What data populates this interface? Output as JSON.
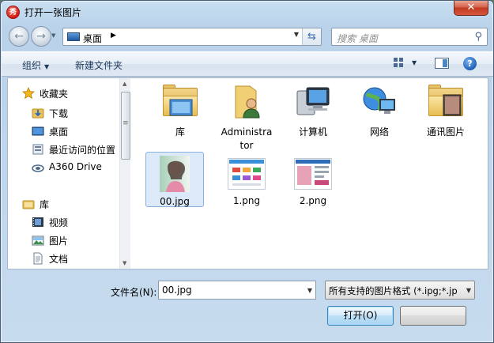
{
  "window": {
    "title": "打开一张图片",
    "app_icon_glyph": "秀",
    "close_glyph": "✕"
  },
  "nav": {
    "address_text": "桌面",
    "search_placeholder": "搜索 桌面"
  },
  "toolbar": {
    "organize_label": "组织",
    "new_folder_label": "新建文件夹",
    "help_glyph": "?"
  },
  "sidebar": {
    "items": [
      {
        "label": "收藏夹",
        "icon": "star-icon"
      },
      {
        "label": "下载",
        "icon": "download-folder-icon"
      },
      {
        "label": "桌面",
        "icon": "desktop-icon"
      },
      {
        "label": "最近访问的位置",
        "icon": "recent-places-icon"
      },
      {
        "label": "A360 Drive",
        "icon": "cloud-drive-icon"
      },
      {
        "label": "库",
        "icon": "library-icon"
      },
      {
        "label": "视频",
        "icon": "video-icon"
      },
      {
        "label": "图片",
        "icon": "pictures-icon"
      },
      {
        "label": "文档",
        "icon": "documents-icon"
      }
    ]
  },
  "files": {
    "items": [
      {
        "label": "库",
        "icon": "library-folder-icon"
      },
      {
        "label": "Administra\ntor",
        "icon": "user-folder-icon"
      },
      {
        "label": "计算机",
        "icon": "computer-icon"
      },
      {
        "label": "网络",
        "icon": "network-icon"
      },
      {
        "label": "通讯图片",
        "icon": "image-folder-icon"
      },
      {
        "label": "00.jpg",
        "icon": "photo-thumbnail-icon",
        "selected": true
      },
      {
        "label": "1.png",
        "icon": "png-thumbnail-icon"
      },
      {
        "label": "2.png",
        "icon": "png-thumbnail-icon"
      }
    ]
  },
  "footer": {
    "filename_label": "文件名(N):",
    "filename_value": "00.jpg",
    "filetype_value": "所有支持的图片格式 (*.ipg;*.jp",
    "open_label": "打开(O)"
  }
}
